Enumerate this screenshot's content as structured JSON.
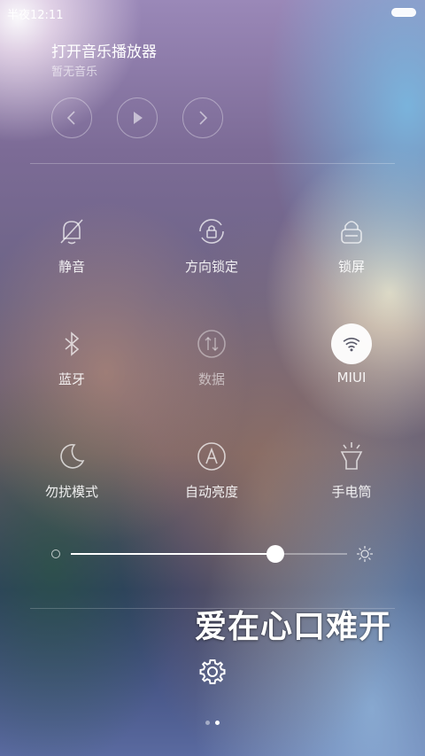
{
  "status_bar": {
    "time": "半夜12:11"
  },
  "music": {
    "title": "打开音乐播放器",
    "subtitle": "暂无音乐",
    "controls": [
      "previous-icon",
      "play-icon",
      "next-icon"
    ]
  },
  "toggles": [
    {
      "label": "静音",
      "icon": "bell-off-icon",
      "state": "off"
    },
    {
      "label": "方向锁定",
      "icon": "rotation-lock-icon",
      "state": "off"
    },
    {
      "label": "锁屏",
      "icon": "lock-icon",
      "state": "off"
    },
    {
      "label": "蓝牙",
      "icon": "bluetooth-icon",
      "state": "off"
    },
    {
      "label": "数据",
      "icon": "data-icon",
      "state": "disabled"
    },
    {
      "label": "MIUI",
      "icon": "wifi-icon",
      "state": "on"
    },
    {
      "label": "勿扰模式",
      "icon": "moon-icon",
      "state": "off"
    },
    {
      "label": "自动亮度",
      "icon": "auto-brightness-icon",
      "state": "off"
    },
    {
      "label": "手电筒",
      "icon": "flashlight-icon",
      "state": "off"
    }
  ],
  "brightness": {
    "value_fraction": 0.74
  },
  "overlay_text": "爱在心口难开",
  "page_indicator": {
    "count": 2,
    "current": 2
  }
}
